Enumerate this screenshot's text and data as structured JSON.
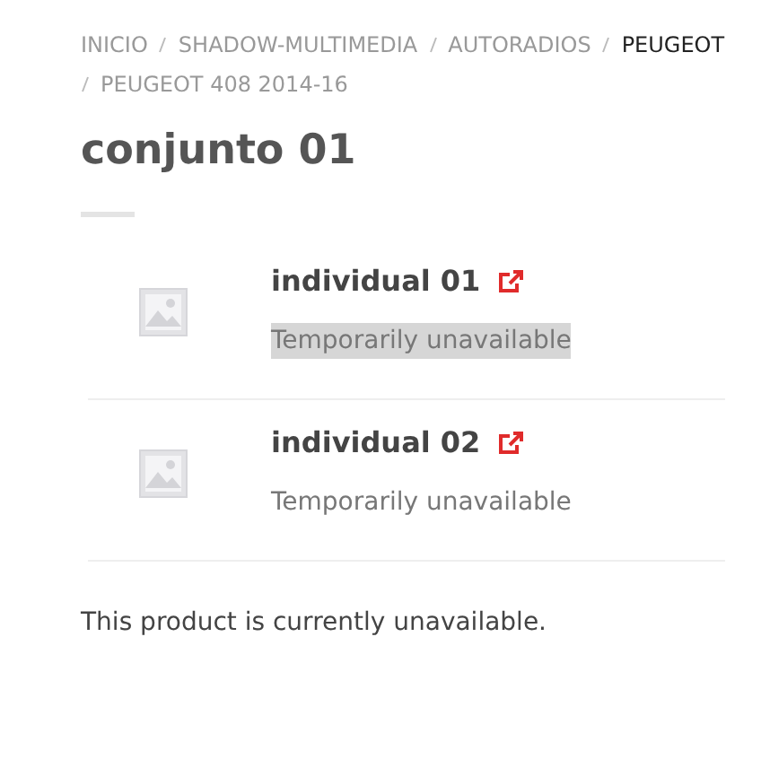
{
  "breadcrumb": [
    {
      "label": "INICIO",
      "current": false
    },
    {
      "label": "SHADOW-MULTIMEDIA",
      "current": false
    },
    {
      "label": "AUTORADIOS",
      "current": false
    },
    {
      "label": "PEUGEOT",
      "current": true
    },
    {
      "label": "PEUGEOT 408 2014-16",
      "current": false
    }
  ],
  "title": "conjunto 01",
  "items": [
    {
      "name": "individual 01",
      "status": "Temporarily unavailable",
      "highlighted": true
    },
    {
      "name": "individual 02",
      "status": "Temporarily unavailable",
      "highlighted": false
    }
  ],
  "note": "This product is currently unavailable."
}
